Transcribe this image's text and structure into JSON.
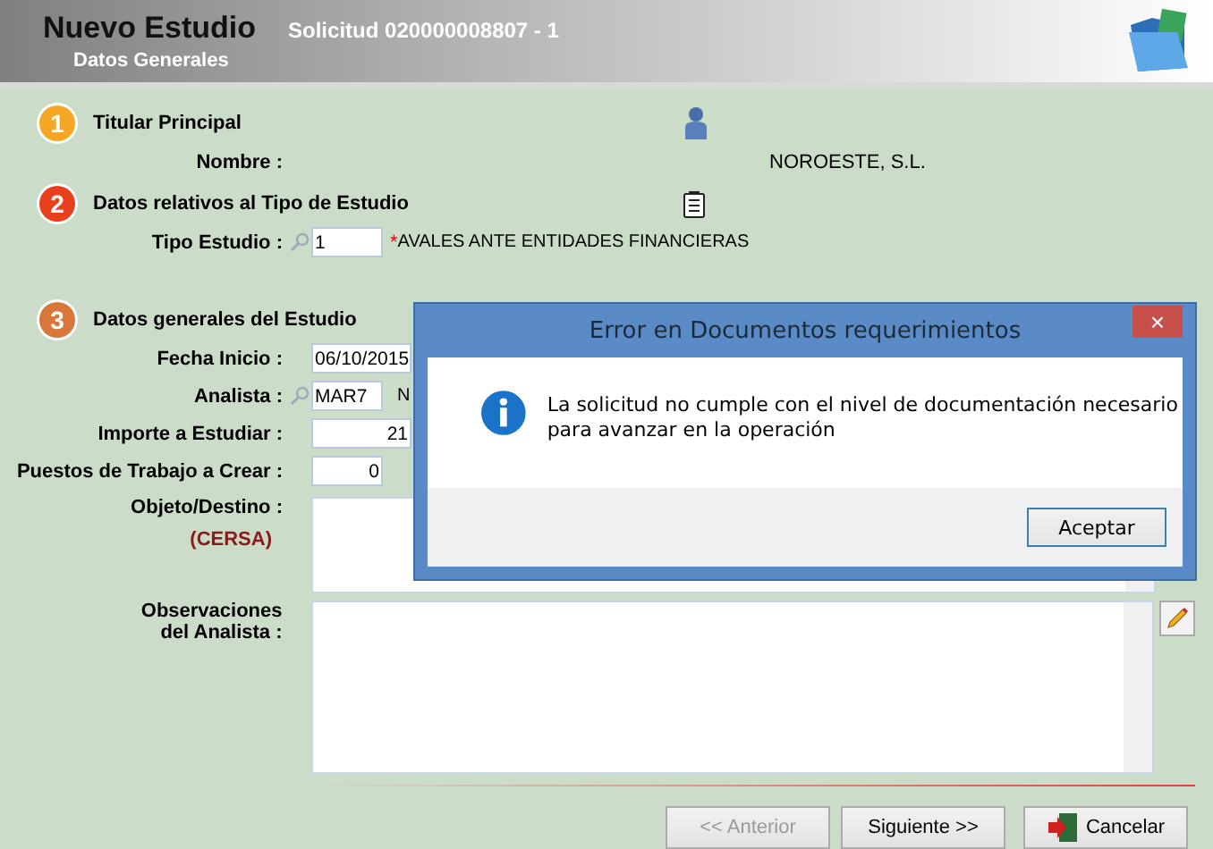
{
  "header": {
    "title": "Nuevo Estudio",
    "subtitle": "Solicitud 020000008807 - 1",
    "section": "Datos Generales"
  },
  "sections": [
    {
      "number": "1",
      "color": "#f5a623",
      "title": "Titular Principal",
      "fields": [
        {
          "kind": "text",
          "label": "Nombre :",
          "value": "NOROESTE, S.L."
        }
      ]
    },
    {
      "number": "2",
      "color": "#e8401c",
      "title": "Datos relativos al Tipo de Estudio",
      "fields": [
        {
          "kind": "lookup",
          "label": "Tipo Estudio :",
          "value": "1",
          "marker": "*",
          "description": "AVALES ANTE ENTIDADES FINANCIERAS"
        }
      ]
    },
    {
      "number": "3",
      "color": "#d9773a",
      "title": "Datos generales del Estudio",
      "fields": [
        {
          "kind": "input",
          "label": "Fecha Inicio :",
          "value": "06/10/2015"
        },
        {
          "kind": "lookup",
          "label": "Analista :",
          "value": "MAR7",
          "description": "N"
        },
        {
          "kind": "number",
          "label": "Importe a Estudiar :",
          "value": "21"
        },
        {
          "kind": "number",
          "label": "Puestos de Trabajo a Crear :",
          "value": "0"
        },
        {
          "kind": "textarea",
          "label": "Objeto/Destino :",
          "note": "(CERSA)"
        },
        {
          "kind": "textarea",
          "label": "Observaciones del Analista :",
          "editable": true
        }
      ]
    }
  ],
  "buttons": [
    {
      "label": "<< Anterior",
      "disabled": true
    },
    {
      "label": "Siguiente >>",
      "disabled": false
    },
    {
      "label": "Cancelar",
      "disabled": false
    }
  ],
  "dialog": {
    "title": "Error en Documentos requerimientos",
    "close": "×",
    "message": "La solicitud no cumple con el nivel de documentación necesario para avanzar en la operación",
    "button": "Aceptar"
  }
}
